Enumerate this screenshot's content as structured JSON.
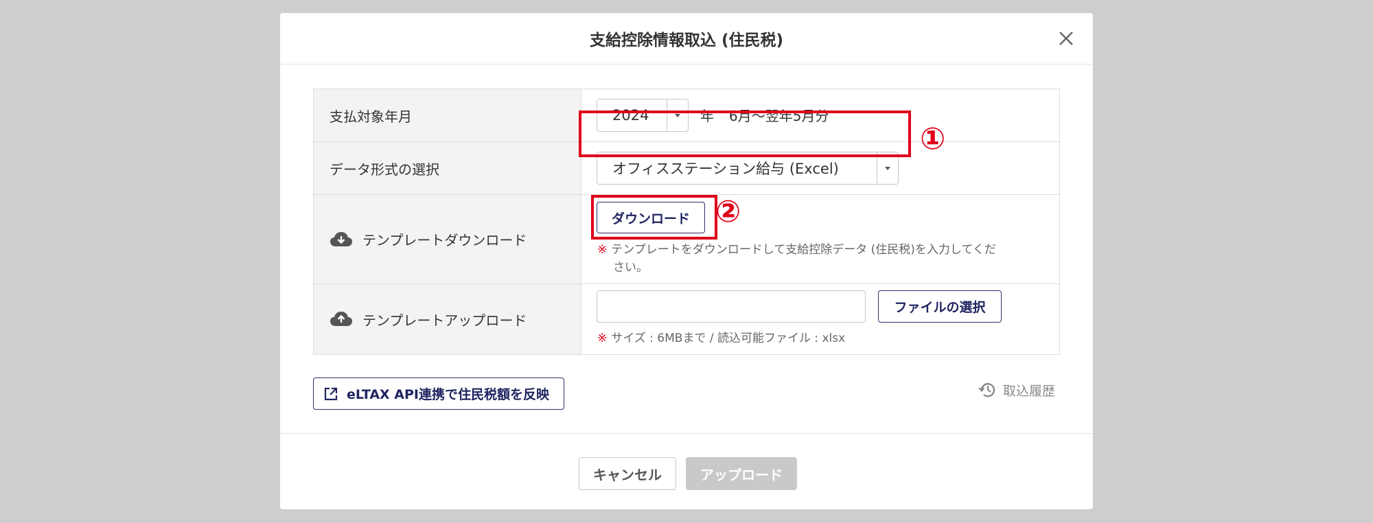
{
  "modal": {
    "title": "支給控除情報取込 (住民税)"
  },
  "rows": {
    "payment_period": {
      "label": "支払対象年月",
      "year_value": "2024",
      "year_suffix": "年",
      "period_text": "6月〜翌年5月分"
    },
    "data_format": {
      "label": "データ形式の選択",
      "selected": "オフィスステーション給与 (Excel)"
    },
    "template_download": {
      "label": "テンプレートダウンロード",
      "button": "ダウンロード",
      "note_mark": "※",
      "note_line1": "テンプレートをダウンロードして支給控除データ (住民税)を入力してくだ",
      "note_line2": "さい。"
    },
    "template_upload": {
      "label": "テンプレートアップロード",
      "file_input_value": "",
      "button": "ファイルの選択",
      "note_mark": "※",
      "note": "サイズ : 6MBまで / 読込可能ファイル : xlsx"
    }
  },
  "annotations": {
    "marker1": "①",
    "marker2": "②",
    "color": "#e0001a"
  },
  "eltax_button": "eLTAX API連携で住民税額を反映",
  "history_link": "取込履歴",
  "footer": {
    "cancel": "キャンセル",
    "upload": "アップロード"
  },
  "icons": [
    "close-icon",
    "cloud-download-icon",
    "cloud-upload-icon",
    "external-link-icon",
    "history-icon",
    "caret-down-icon"
  ],
  "colors": {
    "accent": "#1f2460",
    "highlight": "#e0001a",
    "disabled": "#c9c9c9"
  }
}
